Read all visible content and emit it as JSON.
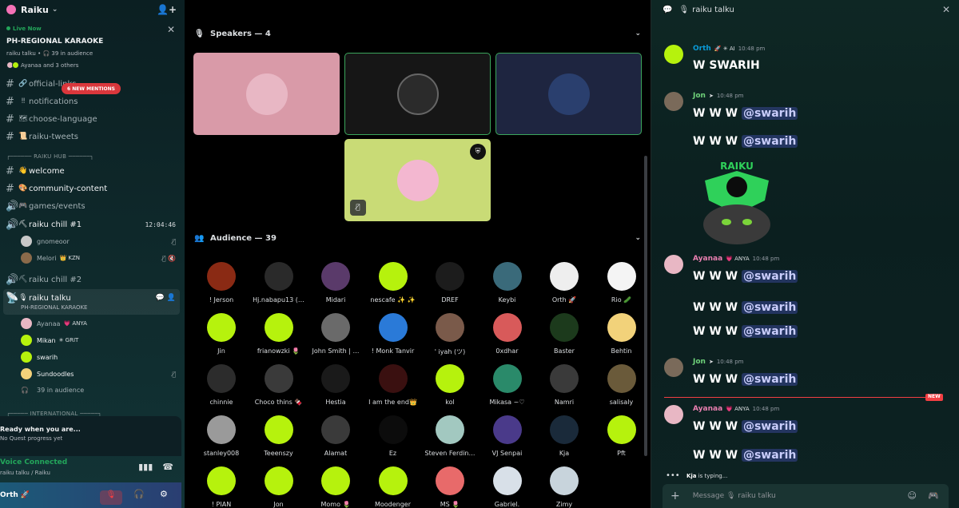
{
  "server": {
    "name": "Raiku",
    "invite_icon": "add-user-icon"
  },
  "live": {
    "tag": "Live Now",
    "title": "PH-REGIONAL KARAOKE",
    "meta": "raiku talku • 🎧 39 in audience",
    "speakers": "Ayanaa and 3 others"
  },
  "sidebar": {
    "channels_top": [
      {
        "name": "official-links",
        "emoji": "🔗"
      },
      {
        "name": "notifications",
        "emoji": "‼"
      },
      {
        "name": "choose-language",
        "emoji": "🗺"
      },
      {
        "name": "raiku-tweets",
        "emoji": "📜"
      }
    ],
    "mention_badge": "6 NEW MENTIONS",
    "cat_hub": "┌────── RAIKU HUB ──────┐",
    "hub_channels": [
      {
        "name": "welcome",
        "emoji": "👋"
      },
      {
        "name": "community-content",
        "emoji": "🎨"
      },
      {
        "name": "games/events",
        "emoji": "🎮"
      }
    ],
    "voice1": {
      "name": "raiku chill #1",
      "time": "12:04:46"
    },
    "voice1_users": [
      {
        "name": "gnomeoor",
        "badge": ""
      },
      {
        "name": "Melori",
        "badge": "👑 KZN"
      }
    ],
    "voice2": {
      "name": "raiku chill #2"
    },
    "stage": {
      "name": "raiku talku",
      "sub": "PH-REGIONAL KARAOKE"
    },
    "stage_users": [
      {
        "name": "Ayanaa",
        "badge": "💗 ANYA"
      },
      {
        "name": "Mikan",
        "badge": "✳ GRIT"
      },
      {
        "name": "swarih",
        "badge": ""
      },
      {
        "name": "Sundoodles",
        "badge": ""
      }
    ],
    "audience_count": "39 in audience",
    "cat_intl": "┌───── INTERNATIONAL ─────┐"
  },
  "quest": {
    "title": "Ready when you are...",
    "sub": "No Quest progress yet"
  },
  "voice_status": {
    "title": "Voice Connected",
    "sub": "raiku talku / Raiku"
  },
  "me": {
    "name": "Orth 🚀"
  },
  "stage_panel": {
    "speakers_label": "Speakers — 4",
    "audience_label": "Audience — 39",
    "speakers": [
      {
        "bg": "#d99aa8",
        "av": "#e8b7c4"
      },
      {
        "bg": "#161616",
        "av": "#2b2b2b"
      },
      {
        "bg": "#1e2540",
        "av": "#2a3f6e"
      },
      {
        "bg": "#c9db76",
        "av": "#f3b7d0"
      }
    ],
    "audience": [
      "! Jerson",
      "Hj.nabapu13 (…",
      "Midari",
      "nescafe ✨ ✨",
      "DREF",
      "Keybi",
      "Orth 🚀",
      "Rio 🥒",
      "Jin",
      "frianowzki 🌷",
      "John Smith | …",
      "! Monk Tanvir",
      "' iyah (ツ)",
      "0xdhar",
      "Baster",
      "Behtin",
      "chinnie",
      "Choco thins 🍫",
      "Hestia",
      "I am the end👑",
      "kol",
      "Mikasa ~♡",
      "Namri",
      "salisaly",
      "stanley008",
      "Teeenszy",
      "Alamat",
      "Ez",
      "Steven Ferdin…",
      "VJ Senpai",
      "Kja",
      "Pft",
      "! PIAN",
      "Jon",
      "Momo 🌷",
      "Moodenger",
      "MS 🌷",
      "Gabriel.",
      "Zimy"
    ],
    "audience_colors": [
      "#8a2a14",
      "#2a2a2a",
      "#5a3a6a",
      "#b6f20d",
      "#1c1c1c",
      "#3a6a7a",
      "#eeeeee",
      "#f4f4f4",
      "#b6f20d",
      "#b6f20d",
      "#6a6a6a",
      "#2a7ad8",
      "#7a5a4a",
      "#d85a5a",
      "#1c3a1c",
      "#f2d27a",
      "#2c2c2c",
      "#3a3a3a",
      "#1a1a1a",
      "#3a1010",
      "#b6f20d",
      "#2a8a6a",
      "#3a3a3a",
      "#6a5a3a",
      "#9a9a9a",
      "#b6f20d",
      "#3a3a3a",
      "#0c0c0c",
      "#a2c8c0",
      "#4a3a8a",
      "#1a2a3a",
      "#b6f20d",
      "#b6f20d",
      "#b6f20d",
      "#b6f20d",
      "#b6f20d",
      "#e86a6a",
      "#d8e0e8",
      "#c8d4dc"
    ]
  },
  "chat": {
    "title": "raiku talku",
    "messages": [
      {
        "name": "Orth",
        "name_color": "#0a9bd8",
        "role": "🚀 ✳ AI",
        "time": "10:48 pm",
        "text": "W SWARIH",
        "mention": ""
      },
      {
        "name": "Jon",
        "name_color": "#6fd27a",
        "role": "➤",
        "time": "10:48 pm",
        "text": "W W W ",
        "mention": "@swarih"
      },
      {
        "name": "",
        "name_color": "",
        "role": "",
        "time": "",
        "text": "W W W ",
        "mention": "@swarih"
      },
      {
        "name": "Ayanaa",
        "name_color": "#e97fb0",
        "role": "💗 ANYA",
        "time": "10:48 pm",
        "text": "W W W ",
        "mention": "@swarih"
      },
      {
        "name": "",
        "name_color": "",
        "role": "",
        "time": "",
        "text": "W W W ",
        "mention": "@swarih"
      },
      {
        "name": "",
        "name_color": "",
        "role": "",
        "time": "",
        "text": "W W W ",
        "mention": "@swarih"
      },
      {
        "name": "Jon",
        "name_color": "#6fd27a",
        "role": "➤",
        "time": "10:48 pm",
        "text": "W W W ",
        "mention": "@swarih"
      },
      {
        "name": "Ayanaa",
        "name_color": "#e97fb0",
        "role": "💗 ANYA",
        "time": "10:48 pm",
        "text": "W W W ",
        "mention": "@swarih"
      },
      {
        "name": "",
        "name_color": "",
        "role": "",
        "time": "",
        "text": "W W W ",
        "mention": "@swarih"
      }
    ],
    "new_tag": "NEW",
    "typing_user": "Kja",
    "typing_text": " is typing...",
    "input_placeholder": "Message 🎙 raiku talku"
  }
}
